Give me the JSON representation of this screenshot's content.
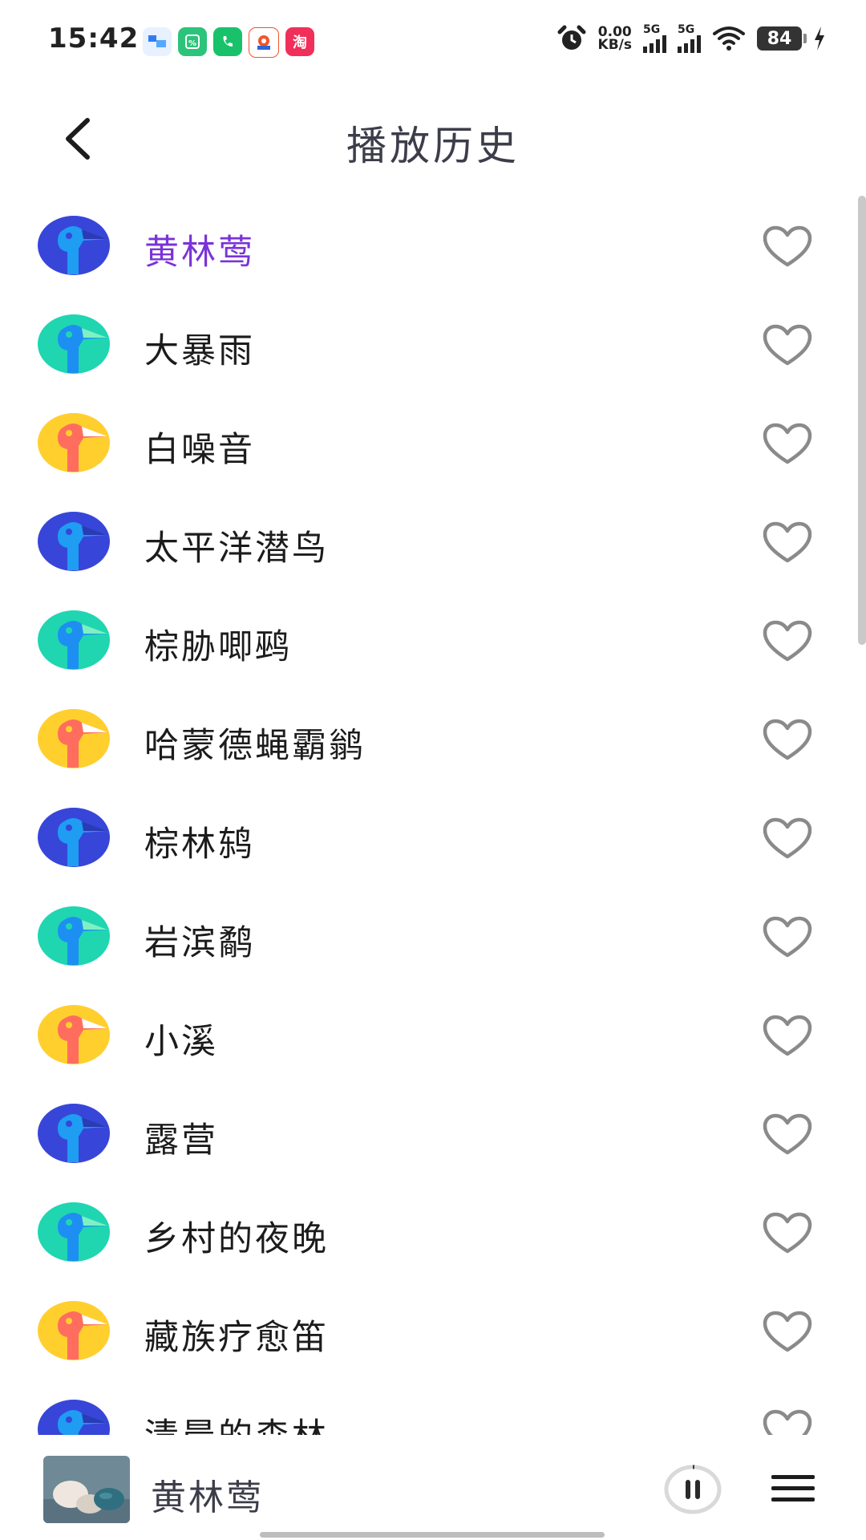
{
  "status_bar": {
    "time": "15:42",
    "net_speed_value": "0.00",
    "net_speed_unit": "KB/s",
    "sim1": "5G",
    "sim2": "5G",
    "battery": "84",
    "apps": [
      {
        "icon": "app-blue-icon",
        "color": "#2f7df2"
      },
      {
        "icon": "app-green-icon",
        "color": "#2cc47a"
      },
      {
        "icon": "phone-app-icon",
        "color": "#19c26a"
      },
      {
        "icon": "app-orange-icon",
        "color": "#f1552b"
      },
      {
        "icon": "taobao-icon",
        "label": "淘",
        "color": "#f0305a"
      }
    ]
  },
  "header": {
    "title": "播放历史",
    "back_icon": "chevron-left-icon"
  },
  "colors": {
    "accent": "#7a33d8",
    "text": "#1c1c1c",
    "heart_stroke": "#8a8a8a",
    "avatar_blue": "#3746d8",
    "avatar_teal": "#1fd6b1",
    "avatar_yellow": "#ffcf2e"
  },
  "history": [
    {
      "name": "黄林莺",
      "avatar": "blue",
      "active": true
    },
    {
      "name": "大暴雨",
      "avatar": "teal",
      "active": false
    },
    {
      "name": "白噪音",
      "avatar": "yellow",
      "active": false
    },
    {
      "name": "太平洋潜鸟",
      "avatar": "blue",
      "active": false
    },
    {
      "name": "棕胁唧鹀",
      "avatar": "teal",
      "active": false
    },
    {
      "name": "哈蒙德蝇霸鹟",
      "avatar": "yellow",
      "active": false
    },
    {
      "name": "棕林鸫",
      "avatar": "blue",
      "active": false
    },
    {
      "name": "岩滨鹬",
      "avatar": "teal",
      "active": false
    },
    {
      "name": "小溪",
      "avatar": "yellow",
      "active": false
    },
    {
      "name": "露营",
      "avatar": "blue",
      "active": false
    },
    {
      "name": "乡村的夜晚",
      "avatar": "teal",
      "active": false
    },
    {
      "name": "藏族疗愈笛",
      "avatar": "yellow",
      "active": false
    },
    {
      "name": "清晨的森林",
      "avatar": "blue",
      "active": false
    }
  ],
  "player": {
    "title": "黄林莺",
    "pause_icon": "pause-icon",
    "menu_icon": "menu-icon"
  }
}
